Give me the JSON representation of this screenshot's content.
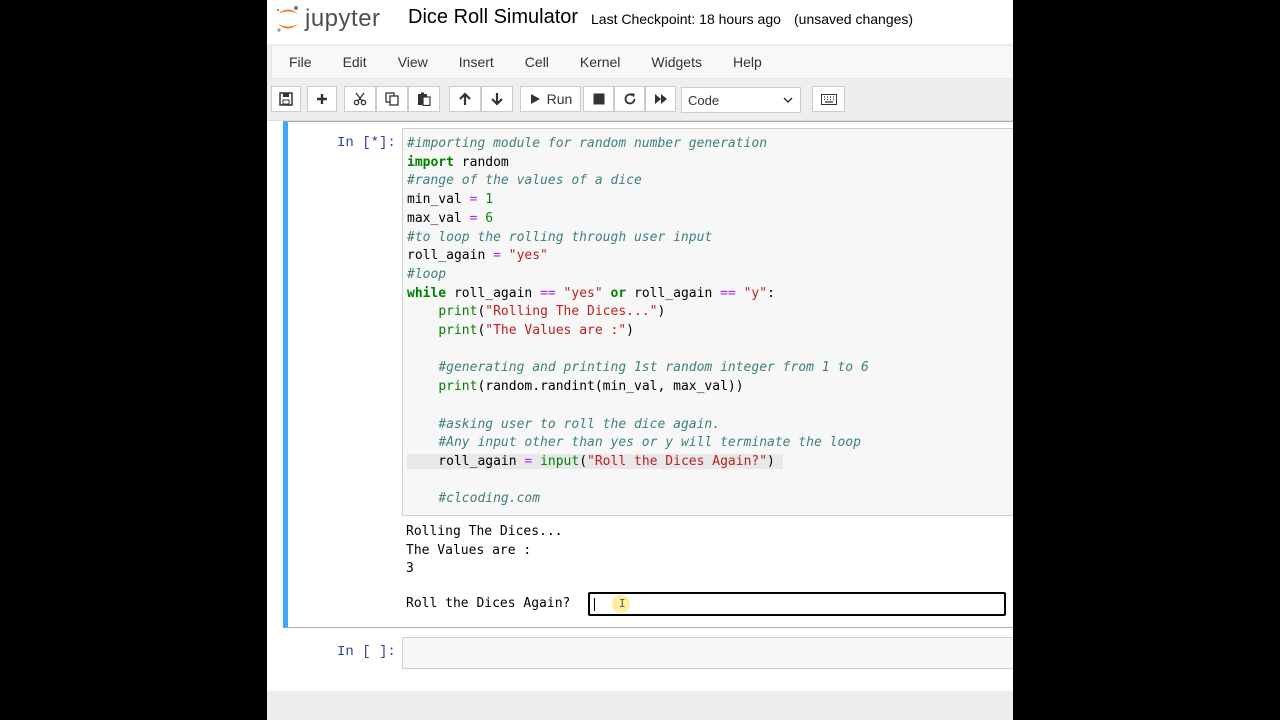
{
  "header": {
    "logo_text": "jupyter",
    "notebook_title": "Dice Roll Simulator",
    "checkpoint": "Last Checkpoint: 18 hours ago",
    "status": "(unsaved changes)"
  },
  "menu": [
    "File",
    "Edit",
    "View",
    "Insert",
    "Cell",
    "Kernel",
    "Widgets",
    "Help"
  ],
  "toolbar": {
    "icons": [
      "save-icon",
      "plus-icon",
      "cut-icon",
      "copy-icon",
      "paste-icon",
      "arrow-up-icon",
      "arrow-down-icon",
      "play-icon",
      "stop-icon",
      "restart-icon",
      "fast-forward-icon",
      "keyboard-icon"
    ],
    "run_label": "Run",
    "cell_type": "Code"
  },
  "cells": [
    {
      "prompt": "In [*]:",
      "code": [
        "#importing module for random number generation",
        "import random",
        "#range of the values of a dice",
        "min_val = 1",
        "max_val = 6",
        "#to loop the rolling through user input",
        "roll_again = \"yes\"",
        "#loop",
        "while roll_again == \"yes\" or roll_again == \"y\":",
        "    print(\"Rolling The Dices...\")",
        "    print(\"The Values are :\")",
        "",
        "    #generating and printing 1st random integer from 1 to 6",
        "    print(random.randint(min_val, max_val))",
        "",
        "    #asking user to roll the dice again.",
        "    #Any input other than yes or y will terminate the loop",
        "    roll_again = input(\"Roll the Dices Again?\")",
        "",
        "    #clcoding.com"
      ],
      "output": [
        "Rolling The Dices...",
        "The Values are :",
        "3"
      ],
      "stdin_prompt": "Roll the Dices Again?",
      "stdin_value": ""
    },
    {
      "prompt": "In [ ]:"
    }
  ],
  "colors": {
    "selected_cell_border": "#42a5f5",
    "prompt": "#303f9f",
    "comment": "#408080",
    "keyword": "#008000",
    "string": "#ba2121",
    "operator": "#aa22ff"
  }
}
